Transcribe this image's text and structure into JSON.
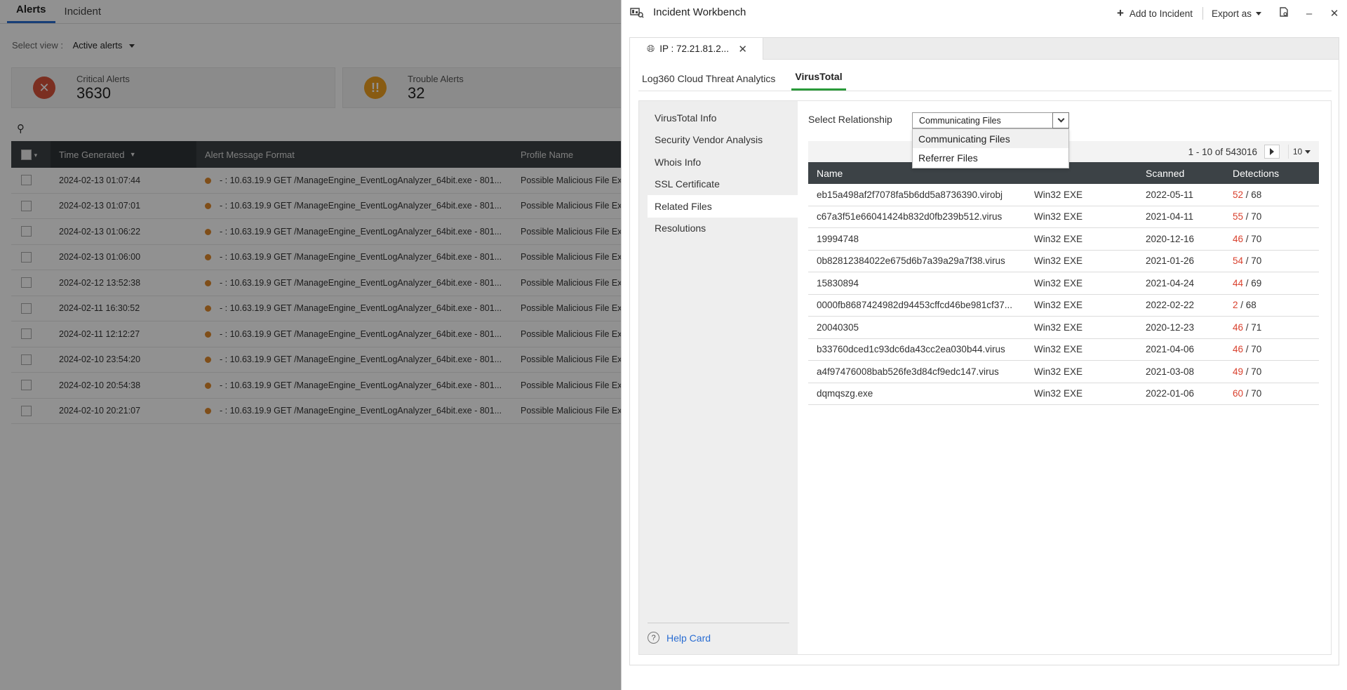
{
  "background": {
    "tabs": [
      "Alerts",
      "Incident"
    ],
    "select_view": {
      "label": "Select view :",
      "value": "Active alerts"
    },
    "cards": [
      {
        "label": "Critical Alerts",
        "value": "3630",
        "icon": "x-circle-icon",
        "color": "#d9533a"
      },
      {
        "label": "Trouble Alerts",
        "value": "32",
        "icon": "exclamation-circle-icon",
        "color": "#f0a020"
      }
    ],
    "grid": {
      "columns": [
        "Time Generated",
        "Alert Message Format",
        "Profile Name"
      ],
      "rows": [
        {
          "time": "2024-02-13 01:07:44",
          "message": "- : 10.63.19.9 GET /ManageEngine_EventLogAnalyzer_64bit.exe - 801...",
          "profile": "Possible Malicious File Ex"
        },
        {
          "time": "2024-02-13 01:07:01",
          "message": "- : 10.63.19.9 GET /ManageEngine_EventLogAnalyzer_64bit.exe - 801...",
          "profile": "Possible Malicious File Ex"
        },
        {
          "time": "2024-02-13 01:06:22",
          "message": "- : 10.63.19.9 GET /ManageEngine_EventLogAnalyzer_64bit.exe - 801...",
          "profile": "Possible Malicious File Ex"
        },
        {
          "time": "2024-02-13 01:06:00",
          "message": "- : 10.63.19.9 GET /ManageEngine_EventLogAnalyzer_64bit.exe - 801...",
          "profile": "Possible Malicious File Ex"
        },
        {
          "time": "2024-02-12 13:52:38",
          "message": "- : 10.63.19.9 GET /ManageEngine_EventLogAnalyzer_64bit.exe - 801...",
          "profile": "Possible Malicious File Ex"
        },
        {
          "time": "2024-02-11 16:30:52",
          "message": "- : 10.63.19.9 GET /ManageEngine_EventLogAnalyzer_64bit.exe - 801...",
          "profile": "Possible Malicious File Ex"
        },
        {
          "time": "2024-02-11 12:12:27",
          "message": "- : 10.63.19.9 GET /ManageEngine_EventLogAnalyzer_64bit.exe - 801...",
          "profile": "Possible Malicious File Ex"
        },
        {
          "time": "2024-02-10 23:54:20",
          "message": "- : 10.63.19.9 GET /ManageEngine_EventLogAnalyzer_64bit.exe - 801...",
          "profile": "Possible Malicious File Ex"
        },
        {
          "time": "2024-02-10 20:54:38",
          "message": "- : 10.63.19.9 GET /ManageEngine_EventLogAnalyzer_64bit.exe - 801...",
          "profile": "Possible Malicious File Ex"
        },
        {
          "time": "2024-02-10 20:21:07",
          "message": "- : 10.63.19.9 GET /ManageEngine_EventLogAnalyzer_64bit.exe - 801...",
          "profile": "Possible Malicious File Ex"
        }
      ]
    }
  },
  "panel": {
    "title": "Incident Workbench",
    "add_to_incident": "Add to Incident",
    "export_as": "Export as",
    "doc_tab": "IP : 72.21.81.2...",
    "sub_tabs": [
      "Log360 Cloud Threat Analytics",
      "VirusTotal"
    ],
    "side_items": [
      "VirusTotal Info",
      "Security Vendor Analysis",
      "Whois Info",
      "SSL Certificate",
      "Related Files",
      "Resolutions"
    ],
    "active_side_item": "Related Files",
    "help_card": "Help Card",
    "relationship": {
      "label": "Select Relationship",
      "value": "Communicating Files",
      "options": [
        "Communicating Files",
        "Referrer Files"
      ]
    },
    "pager": {
      "range": "1 - 10 of 543016",
      "per_page": "10"
    },
    "files": {
      "columns": [
        "Name",
        "",
        "Scanned",
        "Detections"
      ],
      "rows": [
        {
          "name": "eb15a498af2f7078fa5b6dd5a8736390.virobj",
          "type": "Win32 EXE",
          "scanned": "2022-05-11",
          "det": "52",
          "total": "68"
        },
        {
          "name": "c67a3f51e66041424b832d0fb239b512.virus",
          "type": "Win32 EXE",
          "scanned": "2021-04-11",
          "det": "55",
          "total": "70"
        },
        {
          "name": "19994748",
          "type": "Win32 EXE",
          "scanned": "2020-12-16",
          "det": "46",
          "total": "70"
        },
        {
          "name": "0b82812384022e675d6b7a39a29a7f38.virus",
          "type": "Win32 EXE",
          "scanned": "2021-01-26",
          "det": "54",
          "total": "70"
        },
        {
          "name": "15830894",
          "type": "Win32 EXE",
          "scanned": "2021-04-24",
          "det": "44",
          "total": "69"
        },
        {
          "name": "0000fb8687424982d94453cffcd46be981cf37...",
          "type": "Win32 EXE",
          "scanned": "2022-02-22",
          "det": "2",
          "total": "68"
        },
        {
          "name": "20040305",
          "type": "Win32 EXE",
          "scanned": "2020-12-23",
          "det": "46",
          "total": "71"
        },
        {
          "name": "b33760dced1c93dc6da43cc2ea030b44.virus",
          "type": "Win32 EXE",
          "scanned": "2021-04-06",
          "det": "46",
          "total": "70"
        },
        {
          "name": "a4f97476008bab526fe3d84cf9edc147.virus",
          "type": "Win32 EXE",
          "scanned": "2021-03-08",
          "det": "49",
          "total": "70"
        },
        {
          "name": "dqmqszg.exe",
          "type": "Win32 EXE",
          "scanned": "2022-01-06",
          "det": "60",
          "total": "70"
        }
      ]
    }
  },
  "colors": {
    "accent_blue": "#2a6dd2",
    "accent_green": "#2a9a3a",
    "header_dark": "#3c4246",
    "detection_red": "#d9412e"
  }
}
